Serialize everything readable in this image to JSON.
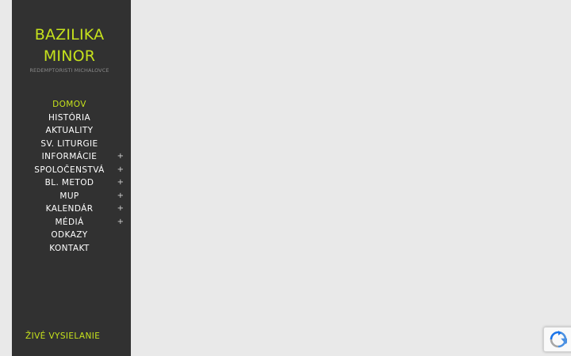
{
  "site": {
    "title_line1": "BAZILIKA",
    "title_line2": "MINOR",
    "tagline": "REDEMPTORISTI MICHALOVCE"
  },
  "nav": {
    "items": [
      {
        "label": "DOMOV",
        "active": true,
        "has_submenu": false
      },
      {
        "label": "HISTÓRIA",
        "active": false,
        "has_submenu": false
      },
      {
        "label": "AKTUALITY",
        "active": false,
        "has_submenu": false
      },
      {
        "label": "SV. LITURGIE",
        "active": false,
        "has_submenu": false
      },
      {
        "label": "INFORMÁCIE",
        "active": false,
        "has_submenu": true
      },
      {
        "label": "SPOLOČENSTVÁ",
        "active": false,
        "has_submenu": true
      },
      {
        "label": "BL. METOD",
        "active": false,
        "has_submenu": true
      },
      {
        "label": "MUP",
        "active": false,
        "has_submenu": true
      },
      {
        "label": "KALENDÁR",
        "active": false,
        "has_submenu": true
      },
      {
        "label": "MÉDIÁ",
        "active": false,
        "has_submenu": true
      },
      {
        "label": "ODKAZY",
        "active": false,
        "has_submenu": false
      },
      {
        "label": "KONTAKT",
        "active": false,
        "has_submenu": false
      }
    ],
    "expand_symbol": "+"
  },
  "footer_link": {
    "label": "ŽIVÉ VYSIELANIE"
  },
  "colors": {
    "accent": "#c6e21c",
    "sidebar_bg": "#313131",
    "page_bg": "#e9e9e9"
  },
  "icons": {
    "recaptcha": "recaptcha-icon"
  }
}
